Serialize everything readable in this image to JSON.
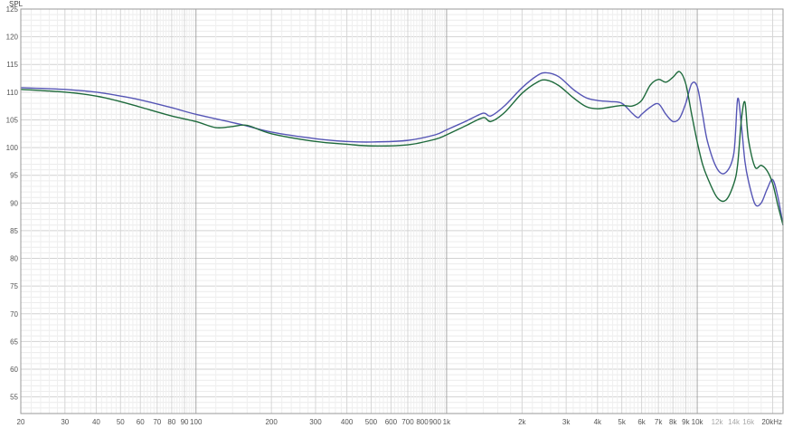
{
  "chart_data": {
    "type": "line",
    "ylabel": "SPL",
    "ylim": [
      52,
      125
    ],
    "xlim": [
      20,
      22000
    ],
    "x_scale": "log",
    "grid": true,
    "y_ticks": [
      55,
      60,
      65,
      70,
      75,
      80,
      85,
      90,
      95,
      100,
      105,
      110,
      115,
      120,
      125
    ],
    "x_ticks": [
      {
        "value": 20,
        "label": "20"
      },
      {
        "value": 30,
        "label": "30"
      },
      {
        "value": 40,
        "label": "40"
      },
      {
        "value": 50,
        "label": "50"
      },
      {
        "value": 60,
        "label": "60"
      },
      {
        "value": 70,
        "label": "70"
      },
      {
        "value": 80,
        "label": "80"
      },
      {
        "value": 90,
        "label": "90"
      },
      {
        "value": 100,
        "label": "100"
      },
      {
        "value": 200,
        "label": "200"
      },
      {
        "value": 300,
        "label": "300"
      },
      {
        "value": 400,
        "label": "400"
      },
      {
        "value": 500,
        "label": "500"
      },
      {
        "value": 600,
        "label": "600"
      },
      {
        "value": 700,
        "label": "700"
      },
      {
        "value": 800,
        "label": "800"
      },
      {
        "value": 900,
        "label": "900"
      },
      {
        "value": 1000,
        "label": "1k"
      },
      {
        "value": 2000,
        "label": "2k"
      },
      {
        "value": 3000,
        "label": "3k"
      },
      {
        "value": 4000,
        "label": "4k"
      },
      {
        "value": 5000,
        "label": "5k"
      },
      {
        "value": 6000,
        "label": "6k"
      },
      {
        "value": 7000,
        "label": "7k"
      },
      {
        "value": 8000,
        "label": "8k"
      },
      {
        "value": 9000,
        "label": "9k"
      },
      {
        "value": 10000,
        "label": "10k"
      },
      {
        "value": 12000,
        "label": "12k",
        "dim": true
      },
      {
        "value": 14000,
        "label": "14k",
        "dim": true
      },
      {
        "value": 16000,
        "label": "16k",
        "dim": true
      },
      {
        "value": 20000,
        "label": "20kHz"
      }
    ],
    "series": [
      {
        "color": "#5555b5",
        "x": [
          20,
          30,
          40,
          50,
          60,
          80,
          100,
          150,
          200,
          300,
          400,
          500,
          700,
          900,
          1000,
          1200,
          1400,
          1500,
          1700,
          2000,
          2300,
          2500,
          2800,
          3200,
          3600,
          4000,
          4500,
          5000,
          5500,
          5800,
          6000,
          6500,
          7000,
          7500,
          8000,
          8500,
          9000,
          9500,
          10000,
          10500,
          11000,
          12000,
          13000,
          14000,
          14500,
          15000,
          15500,
          16000,
          17000,
          18000,
          19000,
          20000,
          21000,
          22000
        ],
        "y": [
          110.8,
          110.5,
          110.0,
          109.3,
          108.6,
          107.2,
          106.0,
          104.2,
          102.8,
          101.6,
          101.1,
          101.0,
          101.3,
          102.3,
          103.2,
          104.8,
          106.2,
          105.7,
          107.5,
          110.8,
          113.0,
          113.5,
          112.8,
          110.5,
          109.0,
          108.5,
          108.3,
          108.0,
          106.2,
          105.4,
          106.0,
          107.3,
          107.9,
          106.0,
          104.7,
          105.3,
          108.0,
          111.5,
          111.0,
          106.0,
          101.0,
          96.2,
          95.5,
          99.0,
          108.8,
          104.0,
          97.5,
          94.0,
          89.8,
          90.0,
          92.5,
          94.2,
          91.0,
          86.0
        ]
      },
      {
        "color": "#1e6a3c",
        "x": [
          20,
          30,
          40,
          50,
          60,
          80,
          100,
          120,
          140,
          160,
          200,
          300,
          400,
          500,
          700,
          900,
          1000,
          1200,
          1400,
          1500,
          1700,
          2000,
          2300,
          2500,
          2800,
          3200,
          3600,
          4000,
          4500,
          5000,
          5500,
          6000,
          6500,
          7000,
          7500,
          8000,
          8500,
          9000,
          9500,
          10000,
          10500,
          11000,
          12000,
          13000,
          14000,
          14500,
          15000,
          15500,
          16000,
          17000,
          18000,
          19000,
          20000,
          21000,
          22000
        ],
        "y": [
          110.5,
          110.0,
          109.3,
          108.3,
          107.3,
          105.7,
          104.7,
          103.6,
          103.8,
          104.0,
          102.5,
          101.1,
          100.6,
          100.3,
          100.5,
          101.5,
          102.3,
          104.0,
          105.4,
          104.7,
          106.3,
          109.8,
          111.8,
          112.2,
          111.2,
          109.0,
          107.4,
          107.0,
          107.3,
          107.6,
          107.5,
          108.5,
          111.3,
          112.3,
          111.8,
          112.7,
          113.7,
          111.5,
          106.0,
          101.0,
          97.0,
          94.5,
          91.0,
          90.5,
          93.5,
          97.0,
          105.0,
          108.2,
          101.5,
          96.5,
          96.8,
          95.8,
          93.5,
          89.5,
          86.0
        ]
      }
    ]
  }
}
